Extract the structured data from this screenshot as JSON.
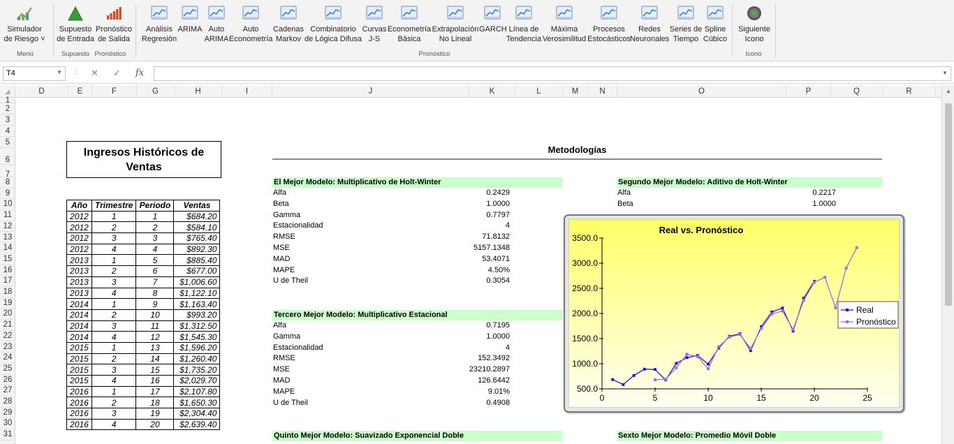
{
  "ribbon": {
    "buttons": [
      {
        "id": "simulador",
        "label1": "Simulador",
        "label2": "de Riesgo ˅",
        "icon": "risk-simulator-icon",
        "color": "#4a90c8"
      },
      {
        "id": "supuesto",
        "label1": "Supuesto",
        "label2": "de Entrada",
        "icon": "input-assumption-icon",
        "color": "#3a9a3a"
      },
      {
        "id": "pronostico-salida",
        "label1": "Pronóstico",
        "label2": "de Salida",
        "icon": "output-forecast-icon",
        "color": "#c84a2a"
      },
      {
        "id": "analisis",
        "label1": "Análisis",
        "label2": "Regresión",
        "icon": "regression-icon",
        "color": "#4a7fc8"
      },
      {
        "id": "arima",
        "label1": "ARIMA",
        "label2": "",
        "icon": "arima-icon",
        "color": "#4a7fc8"
      },
      {
        "id": "auto-arima",
        "label1": "Auto",
        "label2": "ARIMA",
        "icon": "auto-arima-icon",
        "color": "#4a7fc8"
      },
      {
        "id": "auto-econ",
        "label1": "Auto",
        "label2": "Econometría",
        "icon": "auto-econometrics-icon",
        "color": "#4a7fc8"
      },
      {
        "id": "markov",
        "label1": "Cadenas",
        "label2": "Markov",
        "icon": "markov-chain-icon",
        "color": "#4a7fc8"
      },
      {
        "id": "fuzzy",
        "label1": "Combinatorio",
        "label2": "de Lógica Difusa",
        "icon": "fuzzy-logic-icon",
        "color": "#4a7fc8"
      },
      {
        "id": "js",
        "label1": "Curvas",
        "label2": "J-S",
        "icon": "js-curves-icon",
        "color": "#4a7fc8"
      },
      {
        "id": "econ-basica",
        "label1": "Econometría",
        "label2": "Básica",
        "icon": "basic-econometrics-icon",
        "color": "#4a7fc8"
      },
      {
        "id": "extrap",
        "label1": "Extrapolación",
        "label2": "No Lineal",
        "icon": "extrapolation-icon",
        "color": "#4a7fc8"
      },
      {
        "id": "garch",
        "label1": "GARCH",
        "label2": "",
        "icon": "garch-icon",
        "color": "#4a7fc8"
      },
      {
        "id": "linea",
        "label1": "Línea de",
        "label2": "Tendencia",
        "icon": "trendline-icon",
        "color": "#4a7fc8"
      },
      {
        "id": "maxvero",
        "label1": "Máxima",
        "label2": "Verosimilitud",
        "icon": "max-likelihood-icon",
        "color": "#4a7fc8"
      },
      {
        "id": "procesos",
        "label1": "Procesos",
        "label2": "Estocásticos",
        "icon": "stochastic-icon",
        "color": "#4a7fc8"
      },
      {
        "id": "redes",
        "label1": "Redes",
        "label2": "Neuronales",
        "icon": "neural-network-icon",
        "color": "#4a7fc8"
      },
      {
        "id": "series",
        "label1": "Series de",
        "label2": "Tiempo",
        "icon": "time-series-icon",
        "color": "#4a7fc8"
      },
      {
        "id": "spline",
        "label1": "Spline",
        "label2": "Cúbico",
        "icon": "cubic-spline-icon",
        "color": "#4a7fc8"
      },
      {
        "id": "siguiente",
        "label1": "Siguiente",
        "label2": "Icono",
        "icon": "gear-icon",
        "color": "#3a8a3a"
      }
    ],
    "groups": {
      "menu": "Menú",
      "supuesto": "Supuesto",
      "pronostico_small": "Pronóstico",
      "pronostico": "Pronóstico",
      "icono": "Icono"
    }
  },
  "formula_bar": {
    "name_box": "T4",
    "fx": "fx",
    "cancel": "✕",
    "enter": "✓"
  },
  "columns": [
    "D",
    "E",
    "F",
    "G",
    "H",
    "I",
    "J",
    "K",
    "L",
    "M",
    "N",
    "O",
    "P",
    "Q",
    "R"
  ],
  "rows": [
    "1",
    "2",
    "3",
    "4",
    "5",
    "6",
    "7",
    "8",
    "9",
    "10",
    "11",
    "12",
    "13",
    "14",
    "15",
    "16",
    "17",
    "18",
    "19",
    "20",
    "21",
    "22",
    "23",
    "24",
    "25",
    "26",
    "27",
    "28",
    "29",
    "30",
    "31"
  ],
  "historical": {
    "title": "Ingresos Históricos de Ventas",
    "headers": [
      "Año",
      "Trimestre",
      "Periodo",
      "Ventas"
    ],
    "rows": [
      [
        "2012",
        "1",
        "1",
        "$684.20"
      ],
      [
        "2012",
        "2",
        "2",
        "$584.10"
      ],
      [
        "2012",
        "3",
        "3",
        "$765.40"
      ],
      [
        "2012",
        "4",
        "4",
        "$892.30"
      ],
      [
        "2013",
        "1",
        "5",
        "$885.40"
      ],
      [
        "2013",
        "2",
        "6",
        "$677.00"
      ],
      [
        "2013",
        "3",
        "7",
        "$1,006.60"
      ],
      [
        "2013",
        "4",
        "8",
        "$1,122.10"
      ],
      [
        "2014",
        "1",
        "9",
        "$1,163.40"
      ],
      [
        "2014",
        "2",
        "10",
        "$993.20"
      ],
      [
        "2014",
        "3",
        "11",
        "$1,312.50"
      ],
      [
        "2014",
        "4",
        "12",
        "$1,545.30"
      ],
      [
        "2015",
        "1",
        "13",
        "$1,596.20"
      ],
      [
        "2015",
        "2",
        "14",
        "$1,260.40"
      ],
      [
        "2015",
        "3",
        "15",
        "$1,735.20"
      ],
      [
        "2015",
        "4",
        "16",
        "$2,029.70"
      ],
      [
        "2016",
        "1",
        "17",
        "$2,107.80"
      ],
      [
        "2016",
        "2",
        "18",
        "$1,650.30"
      ],
      [
        "2016",
        "3",
        "19",
        "$2,304.40"
      ],
      [
        "2016",
        "4",
        "20",
        "$2,639.40"
      ]
    ]
  },
  "methodologies": {
    "title": "Metodologías",
    "best": {
      "title": "El Mejor Modelo: Multiplicativo de Holt-Winter",
      "rows": [
        [
          "Alfa",
          "0.2429"
        ],
        [
          "Beta",
          "1.0000"
        ],
        [
          "Gamma",
          "0.7797"
        ],
        [
          "Estacionalidad",
          "4"
        ],
        [
          "RMSE",
          "71.8132"
        ],
        [
          "MSE",
          "5157.1348"
        ],
        [
          "MAD",
          "53.4071"
        ],
        [
          "MAPE",
          "4.50%"
        ],
        [
          "U de Theil",
          "0.3054"
        ]
      ]
    },
    "second": {
      "title": "Segundo Mejor Modelo: Aditivo de Holt-Winter",
      "rows": [
        [
          "Alfa",
          "0.2217"
        ],
        [
          "Beta",
          "1.0000"
        ]
      ]
    },
    "third": {
      "title": "Tercero Mejor Modelo: Multiplicativo Estacional",
      "rows": [
        [
          "Alfa",
          "0.7195"
        ],
        [
          "Gamma",
          "1.0000"
        ],
        [
          "Estacionalidad",
          "4"
        ],
        [
          "RMSE",
          "152.3492"
        ],
        [
          "MSE",
          "23210.2897"
        ],
        [
          "MAD",
          "126.6442"
        ],
        [
          "MAPE",
          "9.01%"
        ],
        [
          "U de Theil",
          "0.4908"
        ]
      ]
    },
    "fifth": {
      "title": "Quinto Mejor Modelo: Suavizado Exponencial Doble"
    },
    "sixth": {
      "title": "Sexto Mejor Modelo: Promedio Móvil Doble"
    }
  },
  "chart_data": {
    "type": "line",
    "title": "Real vs. Pronóstico",
    "xlim": [
      0,
      25
    ],
    "ylim": [
      500,
      3500
    ],
    "xticks": [
      0,
      5,
      10,
      15,
      20,
      25
    ],
    "yticks": [
      500,
      1000,
      1500,
      2000,
      2500,
      3000,
      3500
    ],
    "ytick_labels": [
      "500.0",
      "1000.0",
      "1500.0",
      "2000.0",
      "2500.0",
      "3000.0",
      "3500.0"
    ],
    "legend_position": "right",
    "series": [
      {
        "name": "Real",
        "color": "#1a1acc",
        "x": [
          1,
          2,
          3,
          4,
          5,
          6,
          7,
          8,
          9,
          10,
          11,
          12,
          13,
          14,
          15,
          16,
          17,
          18,
          19,
          20
        ],
        "y": [
          684.2,
          584.1,
          765.4,
          892.3,
          885.4,
          677.0,
          1006.6,
          1122.1,
          1163.4,
          993.2,
          1312.5,
          1545.3,
          1596.2,
          1260.4,
          1735.2,
          2029.7,
          2107.8,
          1650.3,
          2304.4,
          2639.4
        ]
      },
      {
        "name": "Pronóstico",
        "color": "#a070d8",
        "x": [
          5,
          6,
          7,
          8,
          9,
          10,
          11,
          12,
          13,
          14,
          15,
          16,
          17,
          18,
          19,
          20,
          21,
          22,
          23,
          24
        ],
        "y": [
          680,
          690,
          920,
          1190,
          1140,
          900,
          1340,
          1530,
          1580,
          1300,
          1700,
          1990,
          2050,
          1680,
          2260,
          2620,
          2720,
          2110,
          2900,
          3310
        ]
      }
    ]
  }
}
